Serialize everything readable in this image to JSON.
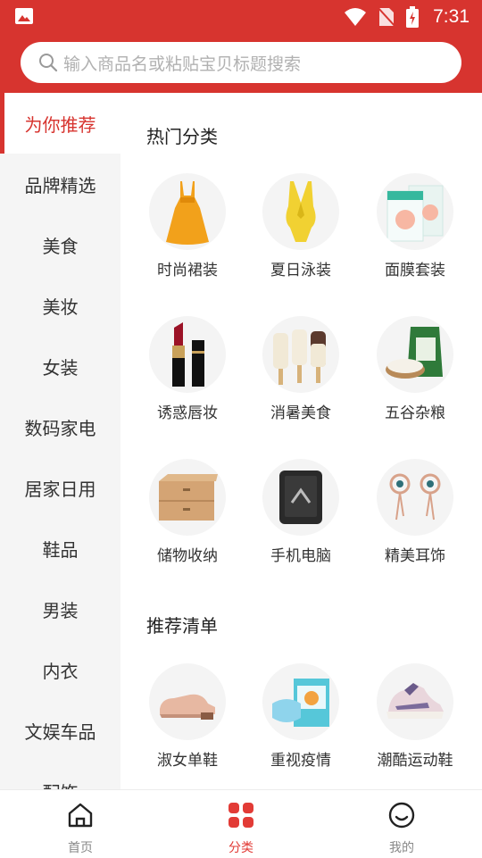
{
  "search": {
    "placeholder": "输入商品名或粘贴宝贝标题搜索"
  },
  "status": {
    "time": "7:31"
  },
  "sidebar": {
    "items": [
      {
        "label": "为你推荐",
        "active": true
      },
      {
        "label": "品牌精选"
      },
      {
        "label": "美食"
      },
      {
        "label": "美妆"
      },
      {
        "label": "女装"
      },
      {
        "label": "数码家电"
      },
      {
        "label": "居家日用"
      },
      {
        "label": "鞋品"
      },
      {
        "label": "男装"
      },
      {
        "label": "内衣"
      },
      {
        "label": "文娱车品"
      },
      {
        "label": "配饰"
      }
    ]
  },
  "main": {
    "hot_title": "热门分类",
    "hot": [
      {
        "label": "时尚裙装",
        "icon": "dress-icon"
      },
      {
        "label": "夏日泳装",
        "icon": "swimsuit-icon"
      },
      {
        "label": "面膜套装",
        "icon": "mask-box-icon"
      },
      {
        "label": "诱惑唇妆",
        "icon": "lipstick-icon"
      },
      {
        "label": "消暑美食",
        "icon": "popsicle-icon"
      },
      {
        "label": "五谷杂粮",
        "icon": "rice-bag-icon"
      },
      {
        "label": "储物收纳",
        "icon": "storage-drawer-icon"
      },
      {
        "label": "手机电脑",
        "icon": "phone-icon"
      },
      {
        "label": "精美耳饰",
        "icon": "earrings-icon"
      }
    ],
    "rec_title": "推荐清单",
    "rec": [
      {
        "label": "淑女单鞋",
        "icon": "loafer-icon"
      },
      {
        "label": "重视疫情",
        "icon": "face-mask-icon"
      },
      {
        "label": "潮酷运动鞋",
        "icon": "sneaker-icon"
      }
    ]
  },
  "tabbar": {
    "items": [
      {
        "label": "首页",
        "icon": "home-icon"
      },
      {
        "label": "分类",
        "icon": "category-icon",
        "active": true
      },
      {
        "label": "我的",
        "icon": "profile-icon"
      }
    ]
  },
  "colors": {
    "brand": "#d7342f",
    "sidebar_bg": "#f5f5f5",
    "inactive_text": "#888888"
  }
}
